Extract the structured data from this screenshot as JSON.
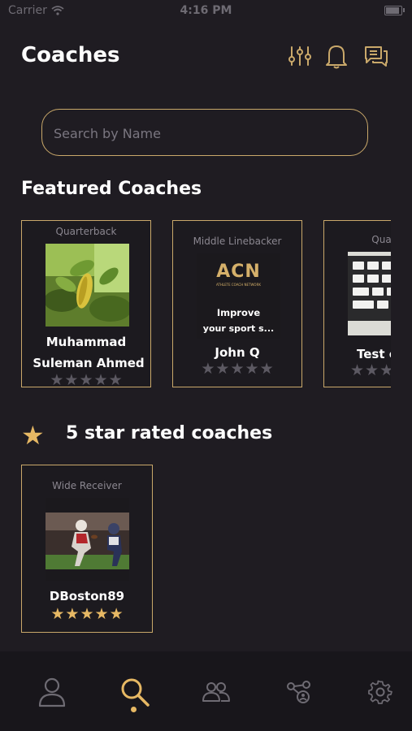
{
  "status_bar": {
    "carrier": "Carrier",
    "time": "4:16 PM"
  },
  "header": {
    "title": "Coaches"
  },
  "search": {
    "placeholder": "Search by Name"
  },
  "featured": {
    "title": "Featured Coaches",
    "cards": [
      {
        "position": "Quarterback",
        "name_line1": "Muhammad",
        "name_line2": "Suleman  Ahmed",
        "rating": 0
      },
      {
        "position": "Middle Linebacker",
        "name": "John Q",
        "rating": 0,
        "logo_text": "ACN",
        "logo_subtext": "ATHLETE COACH NETWORK",
        "promo_line1": "Improve",
        "promo_line2": "your sport s..."
      },
      {
        "position": "Quarte",
        "name": "Test c",
        "rating": 0
      }
    ]
  },
  "five_star": {
    "title": "5 star rated coaches",
    "cards": [
      {
        "position": "Wide Receiver",
        "name": "DBoston89",
        "rating": 5
      }
    ]
  },
  "colors": {
    "accent": "#c9a86a",
    "star": "#e6b864",
    "background": "#1f1c22"
  },
  "bottom_nav": {
    "items": [
      "profile-icon",
      "search-icon",
      "group-icon",
      "network-icon",
      "settings-icon"
    ],
    "active": "search-icon"
  }
}
